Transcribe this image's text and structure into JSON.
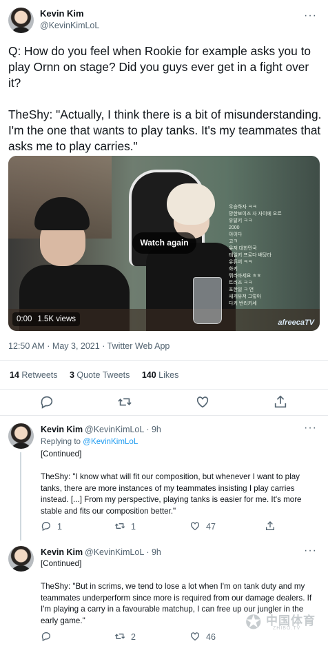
{
  "main_tweet": {
    "author_name": "Kevin Kim",
    "author_handle": "@KevinKimLoL",
    "text": "Q: How do you feel when Rookie for example asks you to play Ornn on stage? Did you guys ever get in a fight over it?\n\nTheShy: \"Actually, I think there is a bit of misunderstanding. I'm the one that wants to play tanks. It's my teammates that asks me to play carries.\"",
    "video": {
      "watch_again_label": "Watch again",
      "time": "0:00",
      "views": "1.5K views",
      "chat_lines": [
        "우승하자 ㅋㅋ",
        "망한보이즈 자 자이에 오르",
        "유달키 ㅋㅋ",
        "2000",
        "아이다",
        "고ㅋ",
        "유저 대한민국",
        "테일키 프로다 배당라",
        "유튜버 ㅋㅋ",
        "화키",
        "뭐라마세요 ㅎㅎ",
        "트러즈 ㅋㅋ",
        "포한일 ㅋ 언",
        "새게유저 그렇아",
        "다키 반리키세"
      ],
      "streamer_logo": "afreecaTV"
    },
    "timestamp": "12:50 AM · May 3, 2021 · Twitter Web App",
    "stats": {
      "retweets_count": "14",
      "retweets_label": "Retweets",
      "quotes_count": "3",
      "quotes_label": "Quote Tweets",
      "likes_count": "140",
      "likes_label": "Likes"
    }
  },
  "replies": [
    {
      "author_name": "Kevin Kim",
      "author_handle": "@KevinKimLoL · 9h",
      "replying_prefix": "Replying to ",
      "replying_to": "@KevinKimLoL",
      "text": "[Continued]\n\nTheShy: \"I know what will fit our composition, but whenever I want to play tanks, there are more instances of my teammates insisting I play carries instead. [...] From my perspective, playing tanks is easier for me. It's more stable and fits our composition better.\"",
      "reply_count": "1",
      "retweet_count": "1",
      "like_count": "47"
    },
    {
      "author_name": "Kevin Kim",
      "author_handle": "@KevinKimLoL · 9h",
      "text": "[Continued]\n\nTheShy: \"But in scrims, we tend to lose a lot when I'm on tank duty and my teammates underperform since more is required from our damage dealers. If I'm playing a carry in a favourable matchup, I can free up our jungler in the early game.\"",
      "reply_count": "",
      "retweet_count": "2",
      "like_count": "46"
    }
  ],
  "watermark": {
    "cn": "中国体育",
    "en": "ZHIBO.TV"
  },
  "icons": {
    "reply": "reply-icon",
    "retweet": "retweet-icon",
    "like": "heart-icon",
    "share": "share-icon",
    "more": "more-icon"
  }
}
